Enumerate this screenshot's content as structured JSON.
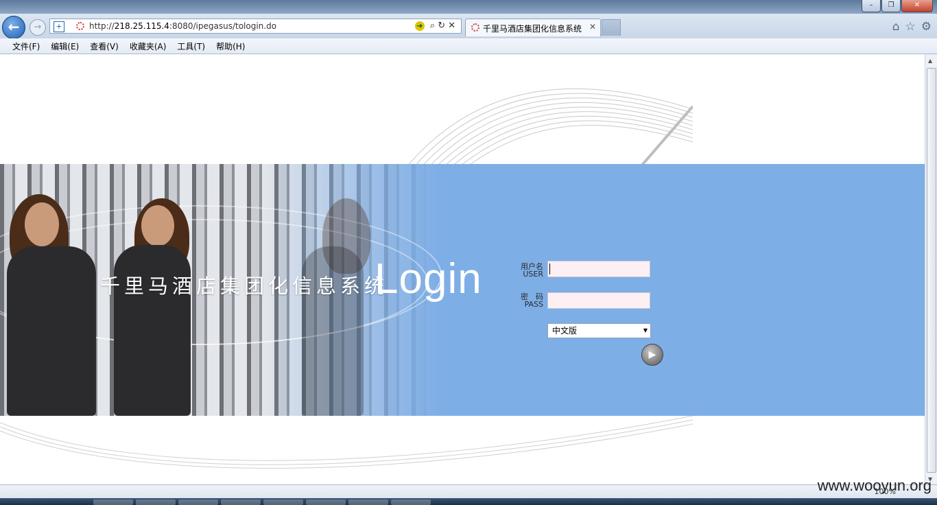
{
  "browser": {
    "url_prefix": "http://",
    "url_host": "218.25.115.4",
    "url_rest": ":8080/ipegasus/tologin.do",
    "tab_title": "千里马酒店集团化信息系统",
    "tab_close": "✕"
  },
  "menu": {
    "items": [
      "文件(F)",
      "编辑(E)",
      "查看(V)",
      "收藏夹(A)",
      "工具(T)",
      "帮助(H)"
    ]
  },
  "login": {
    "system_title": "千里马酒店集团化信息系统",
    "heading": "Login",
    "user_label_cn": "用户名",
    "user_label_en": "USER",
    "pass_label_cn": "密　码",
    "pass_label_en": "PASS",
    "user_value": "",
    "pass_value": "",
    "language_selected": "中文版"
  },
  "status": {
    "zoom": "100%",
    "watermark": "www.wooyun.org"
  },
  "colors": {
    "banner": "#7eaee6",
    "field_bg": "#fdf0f4"
  }
}
